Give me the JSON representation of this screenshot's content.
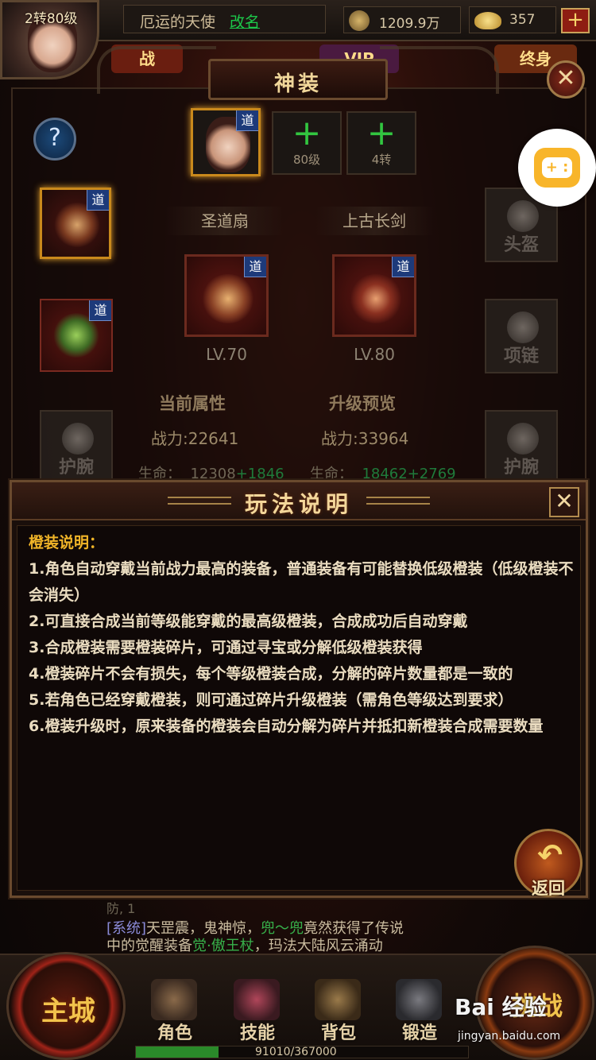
{
  "top": {
    "level": "2转80级",
    "player_name": "厄运的天使",
    "rename": "改名",
    "gold": "1209.9万",
    "ingot": "357",
    "add": "+"
  },
  "banners": [
    "战",
    "VIP",
    "终身"
  ],
  "panel": {
    "title": "神装",
    "close": "✕",
    "help": "?",
    "requirement_slots": [
      {
        "badge": "道"
      },
      {
        "plus": "+",
        "label": "80级"
      },
      {
        "plus": "+",
        "label": "4转"
      }
    ],
    "left_slots": [
      {
        "badge": "道"
      },
      {
        "badge": "道"
      },
      {
        "label": "护腕"
      }
    ],
    "right_slots": [
      {
        "label": "头盔"
      },
      {
        "label": "项链"
      },
      {
        "label": "护腕"
      }
    ],
    "items": [
      {
        "name": "圣道扇",
        "badge": "道",
        "level": "LV.70"
      },
      {
        "name": "上古长剑",
        "badge": "道",
        "level": "LV.80"
      }
    ],
    "current_attr_heading": "当前属性",
    "preview_heading": "升级预览",
    "current_power": "战力:22641",
    "preview_power": "战力:33964",
    "hp_label": "生命：",
    "current_hp": "12308",
    "current_hp_bonus": "+1846",
    "preview_hp": "18462",
    "preview_hp_bonus": "+2769"
  },
  "dialog": {
    "title": "玩法说明",
    "close": "✕",
    "heading": "橙装说明：",
    "rules": [
      "1.角色自动穿戴当前战力最高的装备，普通装备有可能替换低级橙装（低级橙装不会消失）",
      "2.可直接合成当前等级能穿戴的最高级橙装，合成成功后自动穿戴",
      "3.合成橙装需要橙装碎片，可通过寻宝或分解低级橙装获得",
      "4.橙装碎片不会有损失，每个等级橙装合成，分解的碎片数量都是一致的",
      "5.若角色已经穿戴橙装，则可通过碎片升级橙装（需角色等级达到要求）",
      "6.橙装升级时，原来装备的橙装会自动分解为碎片并抵扣新橙装合成需要数量"
    ],
    "back": "返回",
    "back_arrow": "↶"
  },
  "chat": {
    "top_fragment": "防, 1",
    "system_tag": "[系统]",
    "line1_a": "天罡震，鬼神惊，",
    "player": "兜〜兜",
    "line1_b": "竟然获得了传说",
    "line2_a": "中的觉醒装备",
    "item": "觉·傲王杖",
    "line2_b": "，玛法大陆风云涌动"
  },
  "nav": {
    "main_city": "主城",
    "items": [
      "角色",
      "技能",
      "背包",
      "锻造"
    ],
    "combat": "挑战"
  },
  "exp": {
    "text": "91010/367000",
    "fraction": 0.248
  },
  "watermark": {
    "logo": "Bai 经验",
    "url": "jingyan.baidu.com"
  },
  "float_button": {
    "glyph": "+ :"
  },
  "colors": {
    "accent_gold": "#f3d79a",
    "rule_heading": "#f0b428",
    "green": "#32c640",
    "dao_badge": "#1d3a7a"
  }
}
